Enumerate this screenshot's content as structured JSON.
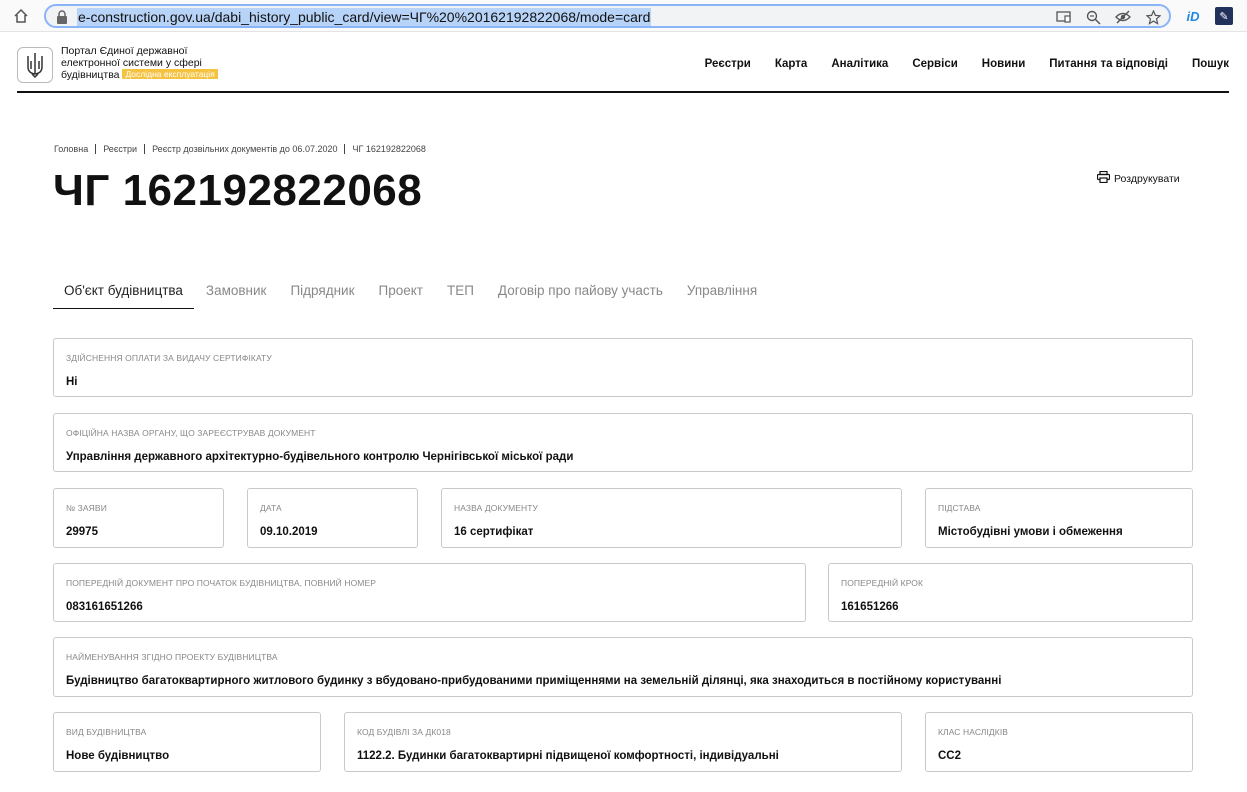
{
  "browser": {
    "url": "e-construction.gov.ua/dabi_history_public_card/view=ЧГ%20%20162192822068/mode=card"
  },
  "header": {
    "portal_title": "Портал Єдиної державної електронної системи у сфері будівництва",
    "badge": "Дослідна експлуатація",
    "nav": [
      "Реєстри",
      "Карта",
      "Аналітика",
      "Сервіси",
      "Новини",
      "Питання та відповіді",
      "Пошук"
    ]
  },
  "breadcrumb": [
    "Головна",
    "Реєстри",
    "Реєстр дозвільних документів до 06.07.2020",
    "ЧГ 162192822068"
  ],
  "page_title": "ЧГ 162192822068",
  "print_label": "Роздрукувати",
  "tabs": [
    "Об'єкт будівництва",
    "Замовник",
    "Підрядник",
    "Проект",
    "ТЕП",
    "Договір про пайову участь",
    "Управління"
  ],
  "fields": {
    "payment": {
      "label": "Здійснення оплати за видачу сертифікату",
      "value": "Ні"
    },
    "authority": {
      "label": "Офіційна назва органу, що зареєстрував документ",
      "value": "Управління державного архітектурно-будівельного контролю Чернігівської міської ради"
    },
    "application_no": {
      "label": "№ заяви",
      "value": "29975"
    },
    "date": {
      "label": "Дата",
      "value": "09.10.2019"
    },
    "doc_name": {
      "label": "Назва документу",
      "value": "16 сертифікат"
    },
    "basis": {
      "label": "Підстава",
      "value": "Містобудівні умови і обмеження"
    },
    "prev_doc": {
      "label": "Попередній документ про початок будівництва, повний номер",
      "value": "083161651266"
    },
    "prev_step": {
      "label": "Попередній крок",
      "value": "161651266"
    },
    "project_name": {
      "label": "Найменування згідно проекту будівництва",
      "value": "Будівництво багатоквартирного житлового будинку з вбудовано-прибудованими приміщеннями на земельній ділянці, яка знаходиться в постійному користуванні"
    },
    "construction_type": {
      "label": "Вид будівництва",
      "value": "Нове будівництво"
    },
    "building_code": {
      "label": "Код будівлі за ДК018",
      "value": "1122.2. Будинки багатоквартирні підвищеної комфортності, індивідуальні"
    },
    "consequence_class": {
      "label": "Клас наслідків",
      "value": "СС2"
    }
  }
}
